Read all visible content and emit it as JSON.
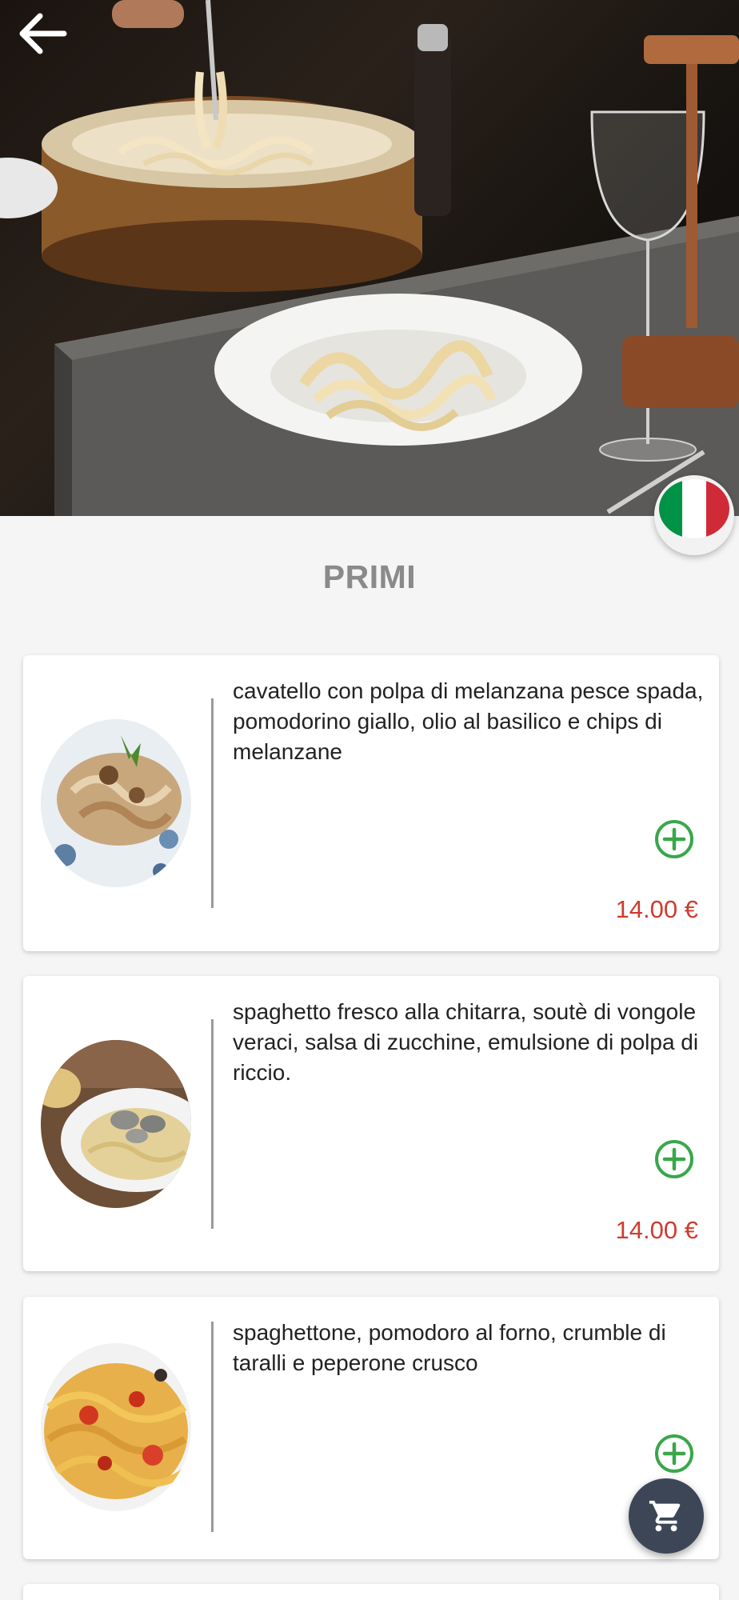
{
  "header": {
    "back_icon": "arrow-left-icon",
    "language_flag": "italian-flag-icon",
    "flag_colors": [
      "#009246",
      "#ffffff",
      "#ce2b37"
    ]
  },
  "section": {
    "title": "PRIMI"
  },
  "menu_items": [
    {
      "description": "cavatello con polpa di melanzana pesce spada, pomodorino giallo, olio al basilico e chips di melanzane",
      "price": "14.00 €",
      "add_icon": "plus-circle-icon"
    },
    {
      "description": "spaghetto fresco alla chitarra, soutè di vongole veraci, salsa di zucchine, emulsione di polpa di riccio.",
      "price": "14.00 €",
      "add_icon": "plus-circle-icon"
    },
    {
      "description": "spaghettone, pomodoro al forno, crumble di taralli e peperone crusco",
      "price": "",
      "add_icon": "plus-circle-icon"
    }
  ],
  "cart": {
    "icon": "shopping-cart-icon"
  },
  "colors": {
    "price": "#cf3b2f",
    "add_button": "#3aa64a",
    "fab": "#3d4657"
  }
}
